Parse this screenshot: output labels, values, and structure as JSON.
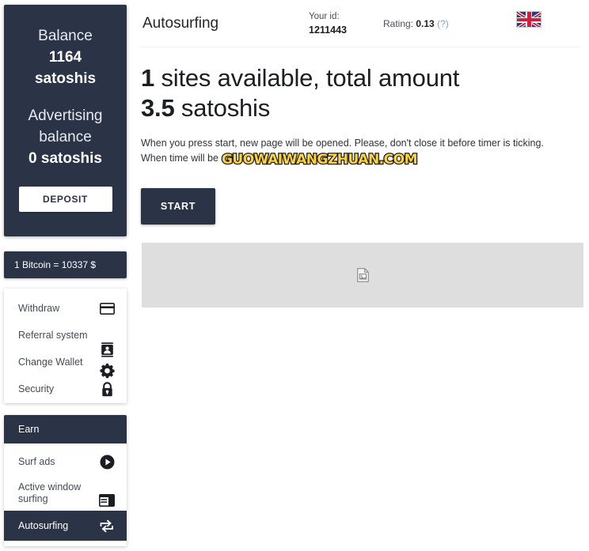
{
  "sidebar": {
    "balance": {
      "label": "Balance",
      "amount": "1164",
      "unit": "satoshis",
      "ad_label_line1": "Advertising",
      "ad_label_line2": "balance",
      "ad_amount": "0 satoshis",
      "deposit_label": "DEPOSIT"
    },
    "rate": "1 Bitcoin = 10337 $",
    "menu": [
      {
        "label": "Withdraw",
        "icon": "credit-card-icon"
      },
      {
        "label": "Referral system",
        "icon": "contact-card-icon"
      },
      {
        "label": "Change Wallet",
        "icon": "gear-icon"
      },
      {
        "label": "Security",
        "icon": "lock-icon"
      }
    ],
    "earn": {
      "header": "Earn",
      "items": [
        {
          "label": "Surf ads",
          "icon": "play-circle-icon",
          "active": false
        },
        {
          "label": "Active window surfing",
          "icon": "window-layout-icon",
          "active": false
        },
        {
          "label": "Autosurfing",
          "icon": "swap-arrows-icon",
          "active": true
        }
      ]
    }
  },
  "header": {
    "title": "Autosurfing",
    "id_label": "Your id:",
    "id_value": "1211443",
    "rating_label": "Rating:",
    "rating_value": "0.13",
    "rating_help": "(?)",
    "flag": "uk-flag-icon"
  },
  "main": {
    "headline_count": "1",
    "headline_mid": " sites available, total amount",
    "headline_amount": "3.5",
    "headline_unit": " satoshis",
    "description_line1": "When you press start, new page will be opened. Please, don't close it before timer is ticking.",
    "description_line2": "When time will be",
    "watermark": "GUOWAIWANGZHUAN.COM",
    "start_label": "START",
    "placeholder_icon": "broken-image-icon"
  },
  "colors": {
    "navy": "#2b3447",
    "placeholder_gray": "#dedede",
    "link_blue": "#7aa7d9",
    "watermark_yellow": "#fdd33b"
  }
}
